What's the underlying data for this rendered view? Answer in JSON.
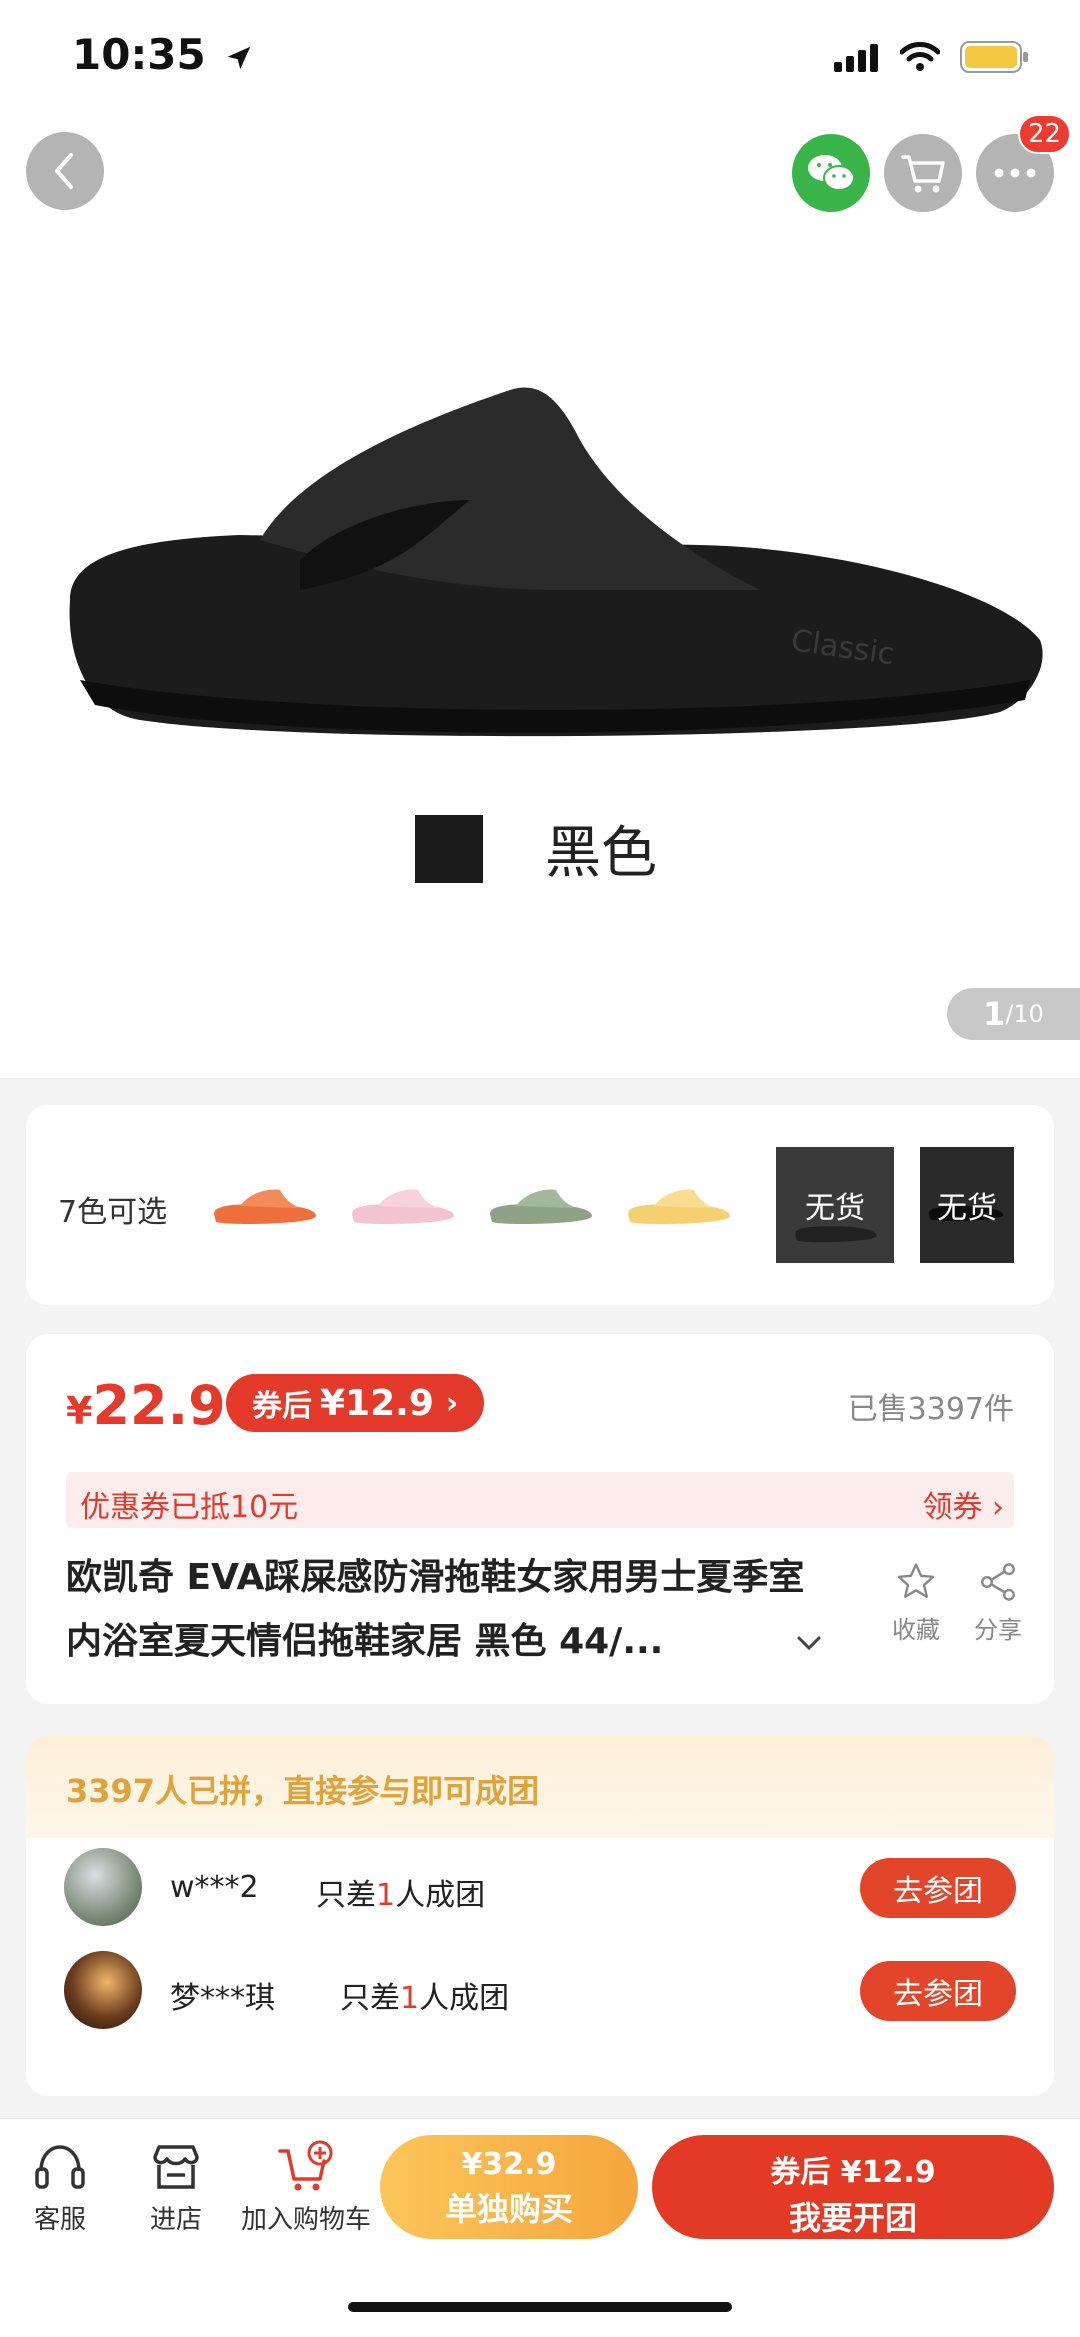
{
  "status_bar": {
    "time": "10:35"
  },
  "header": {
    "cart_badge_count": "22"
  },
  "hero": {
    "color_caption": "黑色",
    "counter_current": "1",
    "counter_total": "/10"
  },
  "variants": {
    "label": "7色可选",
    "items": [
      {
        "name": "orange",
        "color": "#ee6f3b"
      },
      {
        "name": "pink",
        "color": "#f3c3cf"
      },
      {
        "name": "green",
        "color": "#8ea385"
      },
      {
        "name": "yellow",
        "color": "#f5cf70"
      },
      {
        "name": "black",
        "color": "#222222",
        "status": "无货"
      },
      {
        "name": "black-2",
        "color": "#111111",
        "status": "无货"
      }
    ]
  },
  "price": {
    "currency": "¥",
    "value": "22.9",
    "coupon_pill_prefix": "券后",
    "coupon_pill_price": "¥12.9",
    "coupon_pill_arrow": "›",
    "sold": "已售3397件",
    "coupon_bar_text": "优惠券已抵10元",
    "coupon_bar_action": "领券 ›"
  },
  "product": {
    "title": "欧凯奇 EVA踩屎感防滑拖鞋女家用男士夏季室内浴室夏天情侣拖鞋家居 黑色 44/...",
    "fav_label": "收藏",
    "share_label": "分享"
  },
  "group": {
    "header": "3397人已拼，直接参与即可成团",
    "rows": [
      {
        "name": "w***2",
        "need_prefix": "只差",
        "need_count": "1",
        "need_suffix": "人成团",
        "action": "去参团"
      },
      {
        "name": "梦***琪",
        "need_prefix": "只差",
        "need_count": "1",
        "need_suffix": "人成团",
        "action": "去参团"
      }
    ]
  },
  "bottom_bar": {
    "service": "客服",
    "store": "进店",
    "add_cart": "加入购物车",
    "single_price": "¥32.9",
    "single_label": "单独购买",
    "group_price": "券后 ¥12.9",
    "group_label": "我要开团"
  },
  "colors": {
    "accent_red": "#e33a2c",
    "orange": "#f6a63c",
    "green": "#3ab54a"
  }
}
